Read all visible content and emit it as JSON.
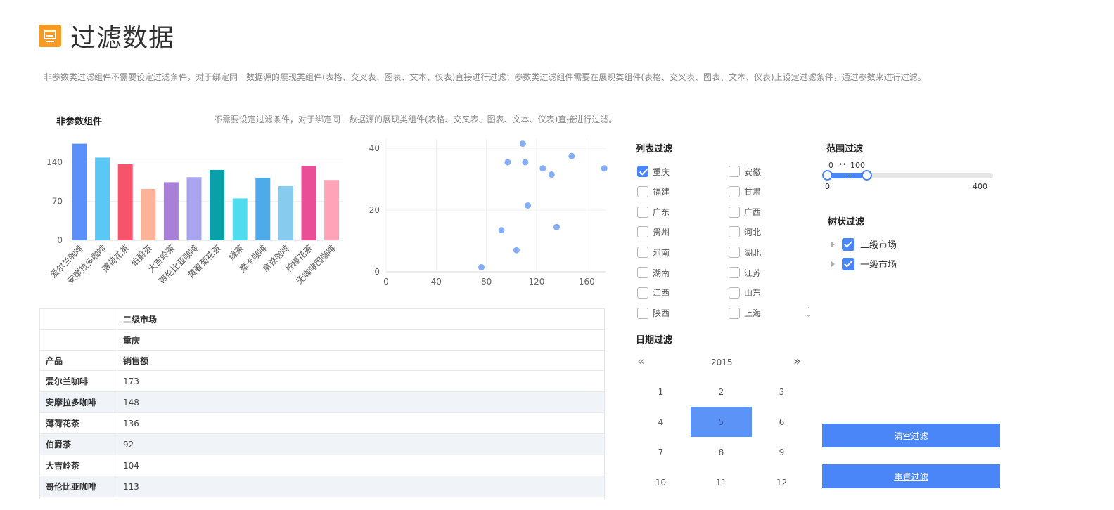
{
  "header": {
    "title": "过滤数据",
    "description": "非参数类过滤组件不需要设定过滤条件，对于绑定同一数据源的展现类组件(表格、交叉表、图表、文本、仪表)直接进行过滤；参数类过滤组件需要在展现类组件(表格、交叉表、图表、文本、仪表)上设定过滤条件，通过参数来进行过滤。"
  },
  "section": {
    "title": "非参数组件",
    "description": "不需要设定过滤条件，对于绑定同一数据源的展现类组件(表格、交叉表、图表、文本、仪表)直接进行过滤。"
  },
  "chart_data": [
    {
      "type": "bar",
      "categories": [
        "爱尔兰咖啡",
        "安摩拉多咖啡",
        "薄荷花茶",
        "伯爵茶",
        "大吉岭茶",
        "哥伦比亚咖啡",
        "黄春菊花茶",
        "绿茶",
        "摩卡咖啡",
        "拿铁咖啡",
        "柠檬花茶",
        "无咖啡因咖啡"
      ],
      "values": [
        173,
        148,
        136,
        92,
        104,
        113,
        126,
        75,
        112,
        97,
        133,
        108
      ],
      "yticks": [
        0,
        70,
        140
      ],
      "ylim": [
        0,
        175
      ],
      "colors": [
        "#5b8ff9",
        "#5ac8f4",
        "#f5546a",
        "#fdb29a",
        "#a880d8",
        "#a9a5ef",
        "#0aa0a9",
        "#4fdcee",
        "#4eaae8",
        "#87cbee",
        "#e94e96",
        "#ffa3b8"
      ]
    },
    {
      "type": "scatter",
      "x": [
        76,
        92,
        97,
        104,
        109,
        111,
        113,
        125,
        132,
        136,
        148,
        174
      ],
      "y": [
        1.5,
        13.5,
        35.5,
        7,
        41.5,
        35.5,
        21.5,
        33.5,
        31.5,
        14.5,
        37.5,
        33.5
      ],
      "xticks": [
        0,
        40,
        80,
        120,
        160
      ],
      "yticks": [
        0,
        20,
        40
      ],
      "xlim": [
        0,
        175
      ],
      "ylim": [
        0,
        43
      ],
      "color": "#86aef7"
    }
  ],
  "crosstab": {
    "level1": "二级市场",
    "level2": "重庆",
    "col_product": "产品",
    "col_sales": "销售额",
    "rows": [
      {
        "product": "爱尔兰咖啡",
        "value": "173"
      },
      {
        "product": "安摩拉多咖啡",
        "value": "148"
      },
      {
        "product": "薄荷花茶",
        "value": "136"
      },
      {
        "product": "伯爵茶",
        "value": "92"
      },
      {
        "product": "大吉岭茶",
        "value": "104"
      },
      {
        "product": "哥伦比亚咖啡",
        "value": "113"
      }
    ]
  },
  "list_filter": {
    "title": "列表过滤",
    "items": [
      {
        "label": "重庆",
        "checked": true
      },
      {
        "label": "安徽",
        "checked": false
      },
      {
        "label": "福建",
        "checked": false
      },
      {
        "label": "甘肃",
        "checked": false
      },
      {
        "label": "广东",
        "checked": false
      },
      {
        "label": "广西",
        "checked": false
      },
      {
        "label": "贵州",
        "checked": false
      },
      {
        "label": "河北",
        "checked": false
      },
      {
        "label": "河南",
        "checked": false
      },
      {
        "label": "湖北",
        "checked": false
      },
      {
        "label": "湖南",
        "checked": false
      },
      {
        "label": "江苏",
        "checked": false
      },
      {
        "label": "江西",
        "checked": false
      },
      {
        "label": "山东",
        "checked": false
      },
      {
        "label": "陕西",
        "checked": false
      },
      {
        "label": "上海",
        "checked": false
      }
    ]
  },
  "range_filter": {
    "title": "范围过滤",
    "low_label": "0",
    "high_label": "100",
    "min_label": "0",
    "max_label": "400",
    "low": 0,
    "high": 100,
    "min": 0,
    "max": 400
  },
  "tree_filter": {
    "title": "树状过滤",
    "items": [
      {
        "label": "二级市场"
      },
      {
        "label": "一级市场"
      }
    ]
  },
  "date_filter": {
    "title": "日期过滤",
    "year": "2015",
    "prev": "«",
    "next": "»",
    "months": [
      "1",
      "2",
      "3",
      "4",
      "5",
      "6",
      "7",
      "8",
      "9",
      "10",
      "11",
      "12"
    ],
    "selected": "5"
  },
  "buttons": {
    "clear": "清空过滤",
    "reset": "重置过滤"
  },
  "colors": {
    "accent": "#4a86f7",
    "logo": "#f59a23"
  }
}
